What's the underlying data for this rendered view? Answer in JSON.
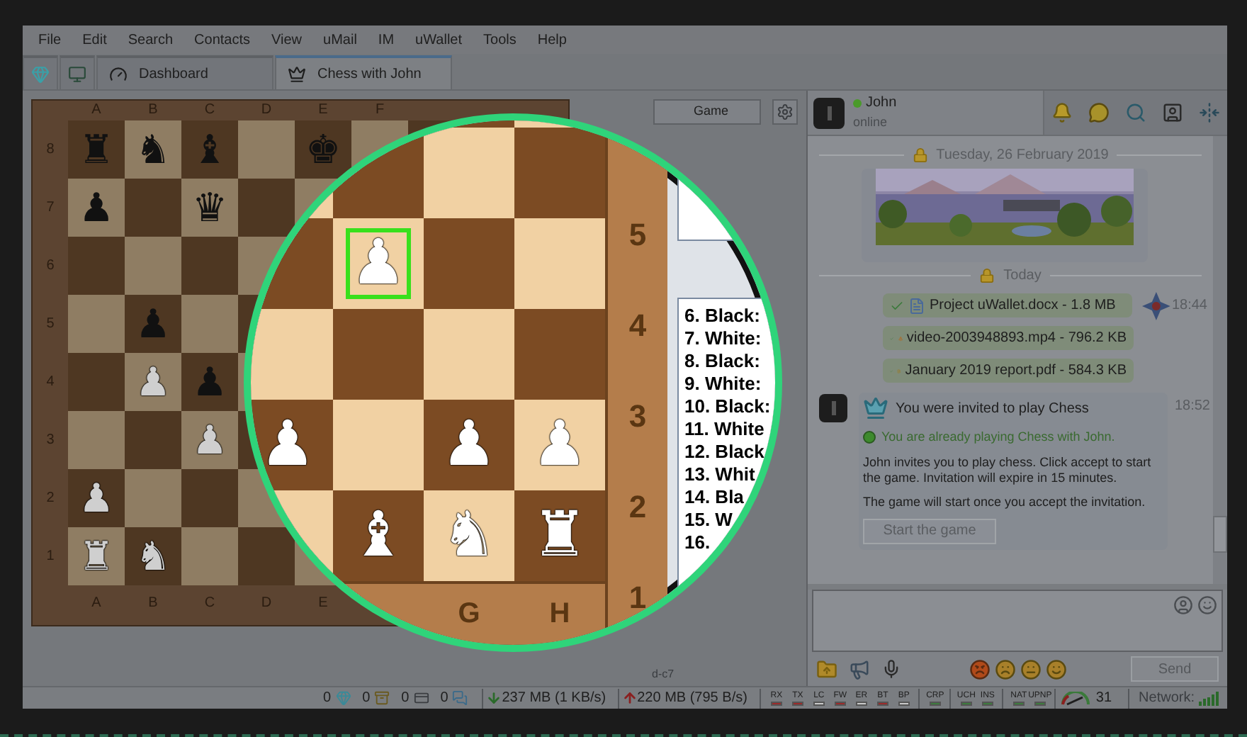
{
  "menu": [
    "File",
    "Edit",
    "Search",
    "Contacts",
    "View",
    "uMail",
    "IM",
    "uWallet",
    "Tools",
    "Help"
  ],
  "tabs": [
    {
      "kind": "icon",
      "selected": false
    },
    {
      "kind": "icon",
      "selected": false
    },
    {
      "kind": "labeled",
      "label": "Dashboard",
      "selected": false
    },
    {
      "kind": "labeled",
      "label": "Chess with John",
      "selected": true
    }
  ],
  "board": {
    "files_top": [
      "A",
      "B",
      "C",
      "D",
      "E",
      "F"
    ],
    "files_bottom": [
      "A",
      "B",
      "C",
      "D",
      "E"
    ],
    "ranks": [
      "8",
      "7",
      "6",
      "5",
      "4",
      "3",
      "2",
      "1"
    ],
    "rows": [
      [
        {
          "glyph": "♜",
          "white": false
        },
        {
          "glyph": "♞",
          "white": false
        },
        {
          "glyph": "♝",
          "white": false
        },
        null,
        {
          "glyph": "♚",
          "white": false
        },
        null,
        null,
        null
      ],
      [
        {
          "glyph": "♟",
          "white": false
        },
        null,
        {
          "glyph": "♛",
          "white": false
        },
        null,
        null,
        null,
        null,
        null
      ],
      [
        null,
        null,
        null,
        null,
        null,
        null,
        null,
        null
      ],
      [
        null,
        {
          "glyph": "♟",
          "white": false
        },
        null,
        null,
        null,
        null,
        null,
        null
      ],
      [
        null,
        {
          "glyph": "♟",
          "white": true
        },
        {
          "glyph": "♟",
          "white": false
        },
        null,
        null,
        null,
        null,
        null
      ],
      [
        null,
        null,
        {
          "glyph": "♟",
          "white": true
        },
        null,
        null,
        null,
        null,
        null
      ],
      [
        {
          "glyph": "♟",
          "white": true
        },
        null,
        null,
        null,
        null,
        null,
        null,
        null
      ],
      [
        {
          "glyph": "♜",
          "white": true
        },
        {
          "glyph": "♞",
          "white": true
        },
        null,
        null,
        null,
        null,
        null,
        null
      ]
    ]
  },
  "game_panel": {
    "game_button": "Game",
    "last_move": "d-c7"
  },
  "magnifier": {
    "files": [
      "G",
      "H"
    ],
    "ranks": [
      "5",
      "4",
      "3",
      "2",
      "1"
    ],
    "rows": [
      [
        null,
        null,
        null,
        null
      ],
      [
        null,
        null,
        null,
        null
      ],
      [
        null,
        {
          "glyph": "♟",
          "white": true,
          "selected": true
        },
        null,
        null
      ],
      [
        null,
        null,
        null,
        null
      ],
      [
        {
          "glyph": "♟",
          "white": true,
          "selected": false
        },
        null,
        {
          "glyph": "♟",
          "white": true,
          "selected": false
        },
        {
          "glyph": "♟",
          "white": true,
          "selected": false
        }
      ],
      [
        null,
        {
          "glyph": "♝",
          "white": true,
          "selected": false
        },
        {
          "glyph": "♞",
          "white": true,
          "selected": false
        },
        {
          "glyph": "♜",
          "white": true,
          "selected": false
        }
      ]
    ],
    "moves": [
      "6. Black:",
      "7. White:",
      "8. Black:",
      "9. White:",
      "10. Black:",
      "11. White",
      "12. Black",
      "13. Whit",
      "14. Bla",
      "15. W",
      "16."
    ]
  },
  "chat": {
    "contact": {
      "name": "John",
      "status": "online",
      "online": true
    },
    "messages": [
      {
        "kind": "date",
        "text": "Tuesday, 26 February 2019"
      },
      {
        "kind": "picture"
      },
      {
        "kind": "date",
        "text": "Today"
      },
      {
        "kind": "document",
        "text": "Project uWallet.docx - 1.8 MB",
        "time": "18:44"
      },
      {
        "kind": "video",
        "text": "video-2003948893.mp4 - 796.2 KB"
      },
      {
        "kind": "pdf",
        "text": "January 2019 report.pdf - 584.3 KB"
      },
      {
        "kind": "invite",
        "time": "18:52",
        "title": "You were invited to play Chess",
        "notice": "You are already playing Chess with John.",
        "body": "John invites you to play chess. Click accept to start the game. Invitation will expire in 15 minutes.",
        "note": "The game will start once you accept the invitation.",
        "button": "Start the game"
      }
    ],
    "send_button": "Send"
  },
  "status_bar": {
    "counters": [
      "0",
      "0",
      "0",
      "0"
    ],
    "download": "237 MB (1 KB/s)",
    "upload": "220 MB (795 B/s)",
    "indicator_groups": [
      {
        "items": [
          {
            "label": "RX",
            "color": "#9b2b2b"
          },
          {
            "label": "TX",
            "color": "#9b2b2b"
          },
          {
            "label": "LC",
            "color": "#c9c9c9"
          },
          {
            "label": "FW",
            "color": "#9b2b2b"
          },
          {
            "label": "ER",
            "color": "#c9c9c9"
          },
          {
            "label": "BT",
            "color": "#9b2b2b"
          },
          {
            "label": "BP",
            "color": "#c9c9c9"
          }
        ]
      },
      {
        "items": [
          {
            "label": "CRP",
            "color": "#3d7a3d"
          }
        ]
      },
      {
        "items": [
          {
            "label": "UCH",
            "color": "#3d7a3d"
          },
          {
            "label": "INS",
            "color": "#3d7a3d"
          }
        ]
      },
      {
        "items": [
          {
            "label": "NAT",
            "color": "#3d7a3d"
          },
          {
            "label": "UPNP",
            "color": "#3d7a3d"
          }
        ]
      }
    ],
    "speed": "31",
    "network_label": "Network:"
  }
}
